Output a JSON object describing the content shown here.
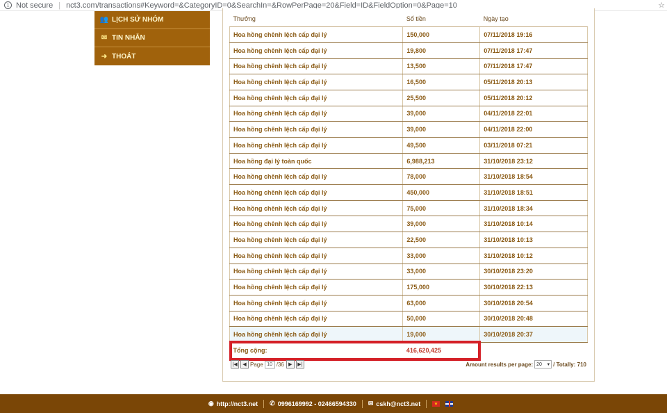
{
  "browser": {
    "security": "Not secure",
    "url": "nct3.com/transactions#Keyword=&CategoryID=0&SearchIn=&RowPerPage=20&Field=ID&FieldOption=0&Page=10"
  },
  "sidebar": {
    "items": [
      {
        "label": "LỊCH SỬ NHÓM",
        "icon": "users-icon"
      },
      {
        "label": "TIN NHẮN",
        "icon": "envelope-icon"
      },
      {
        "label": "THOÁT",
        "icon": "sign-out-icon"
      }
    ]
  },
  "table": {
    "headers": [
      "Thưởng",
      "Số tiền",
      "Ngày tạo"
    ],
    "rows": [
      {
        "type": "Hoa hồng chênh lệch cấp đại lý",
        "amount": "150,000",
        "date": "07/11/2018 19:16"
      },
      {
        "type": "Hoa hồng chênh lệch cấp đại lý",
        "amount": "19,800",
        "date": "07/11/2018 17:47"
      },
      {
        "type": "Hoa hồng chênh lệch cấp đại lý",
        "amount": "13,500",
        "date": "07/11/2018 17:47"
      },
      {
        "type": "Hoa hồng chênh lệch cấp đại lý",
        "amount": "16,500",
        "date": "05/11/2018 20:13"
      },
      {
        "type": "Hoa hồng chênh lệch cấp đại lý",
        "amount": "25,500",
        "date": "05/11/2018 20:12"
      },
      {
        "type": "Hoa hồng chênh lệch cấp đại lý",
        "amount": "39,000",
        "date": "04/11/2018 22:01"
      },
      {
        "type": "Hoa hồng chênh lệch cấp đại lý",
        "amount": "39,000",
        "date": "04/11/2018 22:00"
      },
      {
        "type": "Hoa hồng chênh lệch cấp đại lý",
        "amount": "49,500",
        "date": "03/11/2018 07:21"
      },
      {
        "type": "Hoa hồng đại lý toàn quốc",
        "amount": "6,988,213",
        "date": "31/10/2018 23:12"
      },
      {
        "type": "Hoa hồng chênh lệch cấp đại lý",
        "amount": "78,000",
        "date": "31/10/2018 18:54"
      },
      {
        "type": "Hoa hồng chênh lệch cấp đại lý",
        "amount": "450,000",
        "date": "31/10/2018 18:51"
      },
      {
        "type": "Hoa hồng chênh lệch cấp đại lý",
        "amount": "75,000",
        "date": "31/10/2018 18:34"
      },
      {
        "type": "Hoa hồng chênh lệch cấp đại lý",
        "amount": "39,000",
        "date": "31/10/2018 10:14"
      },
      {
        "type": "Hoa hồng chênh lệch cấp đại lý",
        "amount": "22,500",
        "date": "31/10/2018 10:13"
      },
      {
        "type": "Hoa hồng chênh lệch cấp đại lý",
        "amount": "33,000",
        "date": "31/10/2018 10:12"
      },
      {
        "type": "Hoa hồng chênh lệch cấp đại lý",
        "amount": "33,000",
        "date": "30/10/2018 23:20"
      },
      {
        "type": "Hoa hồng chênh lệch cấp đại lý",
        "amount": "175,000",
        "date": "30/10/2018 22:13"
      },
      {
        "type": "Hoa hồng chênh lệch cấp đại lý",
        "amount": "63,000",
        "date": "30/10/2018 20:54"
      },
      {
        "type": "Hoa hồng chênh lệch cấp đại lý",
        "amount": "50,000",
        "date": "30/10/2018 20:48"
      },
      {
        "type": "Hoa hồng chênh lệch cấp đại lý",
        "amount": "19,000",
        "date": "30/10/2018 20:37"
      }
    ],
    "total_label": "Tổng cộng:",
    "total_value": "416,620,425"
  },
  "pager": {
    "page_label": "Page",
    "current_page": "10",
    "of_pages": "/36",
    "amount_label": "Amount results per page:",
    "per_page": "20",
    "totally": "/ Totally: 710"
  },
  "footer": {
    "website": "http://nct3.net",
    "phones": "0996169992 - 02466594330",
    "email": "cskh@nct3.net"
  },
  "colors": {
    "brand": "#a0620c",
    "footer": "#7a4606",
    "highlight": "#d42027"
  }
}
